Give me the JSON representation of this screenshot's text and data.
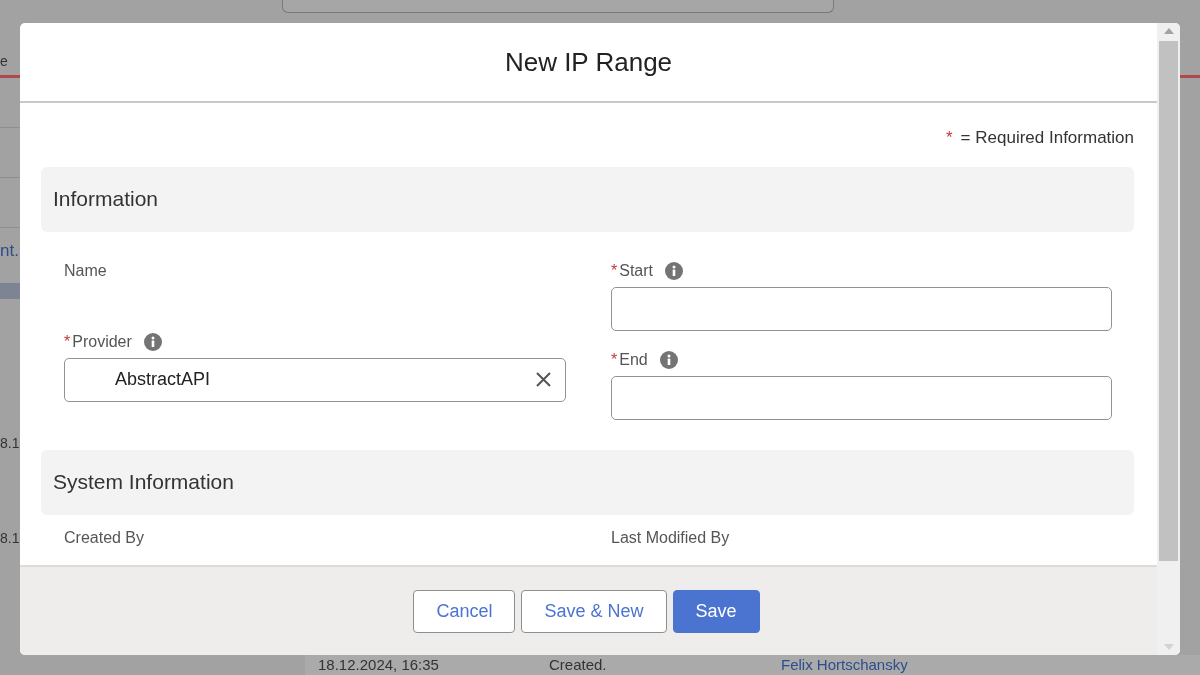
{
  "background": {
    "tab_fragment": "e",
    "link_fragment": "nt.",
    "cells": [
      "8.1",
      "8.1"
    ],
    "history_row": [
      "18.12.2024, 16:35",
      "Created.",
      "Felix Hortschansky"
    ]
  },
  "modal": {
    "title": "New IP Range",
    "required_note": {
      "marker": "*",
      "text": "= Required Information"
    },
    "sections": [
      {
        "title": "Information",
        "left_fields": [
          {
            "label": "Name",
            "kind": "readonly",
            "required": false,
            "info": false
          },
          {
            "label": "Provider",
            "kind": "lookup",
            "required": true,
            "info": true,
            "value": "AbstractAPI"
          }
        ],
        "right_fields": [
          {
            "label": "Start",
            "kind": "text",
            "required": true,
            "info": true
          },
          {
            "label": "End",
            "kind": "text",
            "required": true,
            "info": true
          }
        ]
      },
      {
        "title": "System Information",
        "left_fields": [
          {
            "label": "Created By",
            "kind": "readonly",
            "required": false,
            "info": false
          }
        ],
        "right_fields": [
          {
            "label": "Last Modified By",
            "kind": "readonly",
            "required": false,
            "info": false
          }
        ]
      }
    ],
    "buttons": [
      {
        "label": "Cancel",
        "kind": "neutral"
      },
      {
        "label": "Save & New",
        "kind": "neutral"
      },
      {
        "label": "Save",
        "kind": "brand"
      }
    ]
  }
}
